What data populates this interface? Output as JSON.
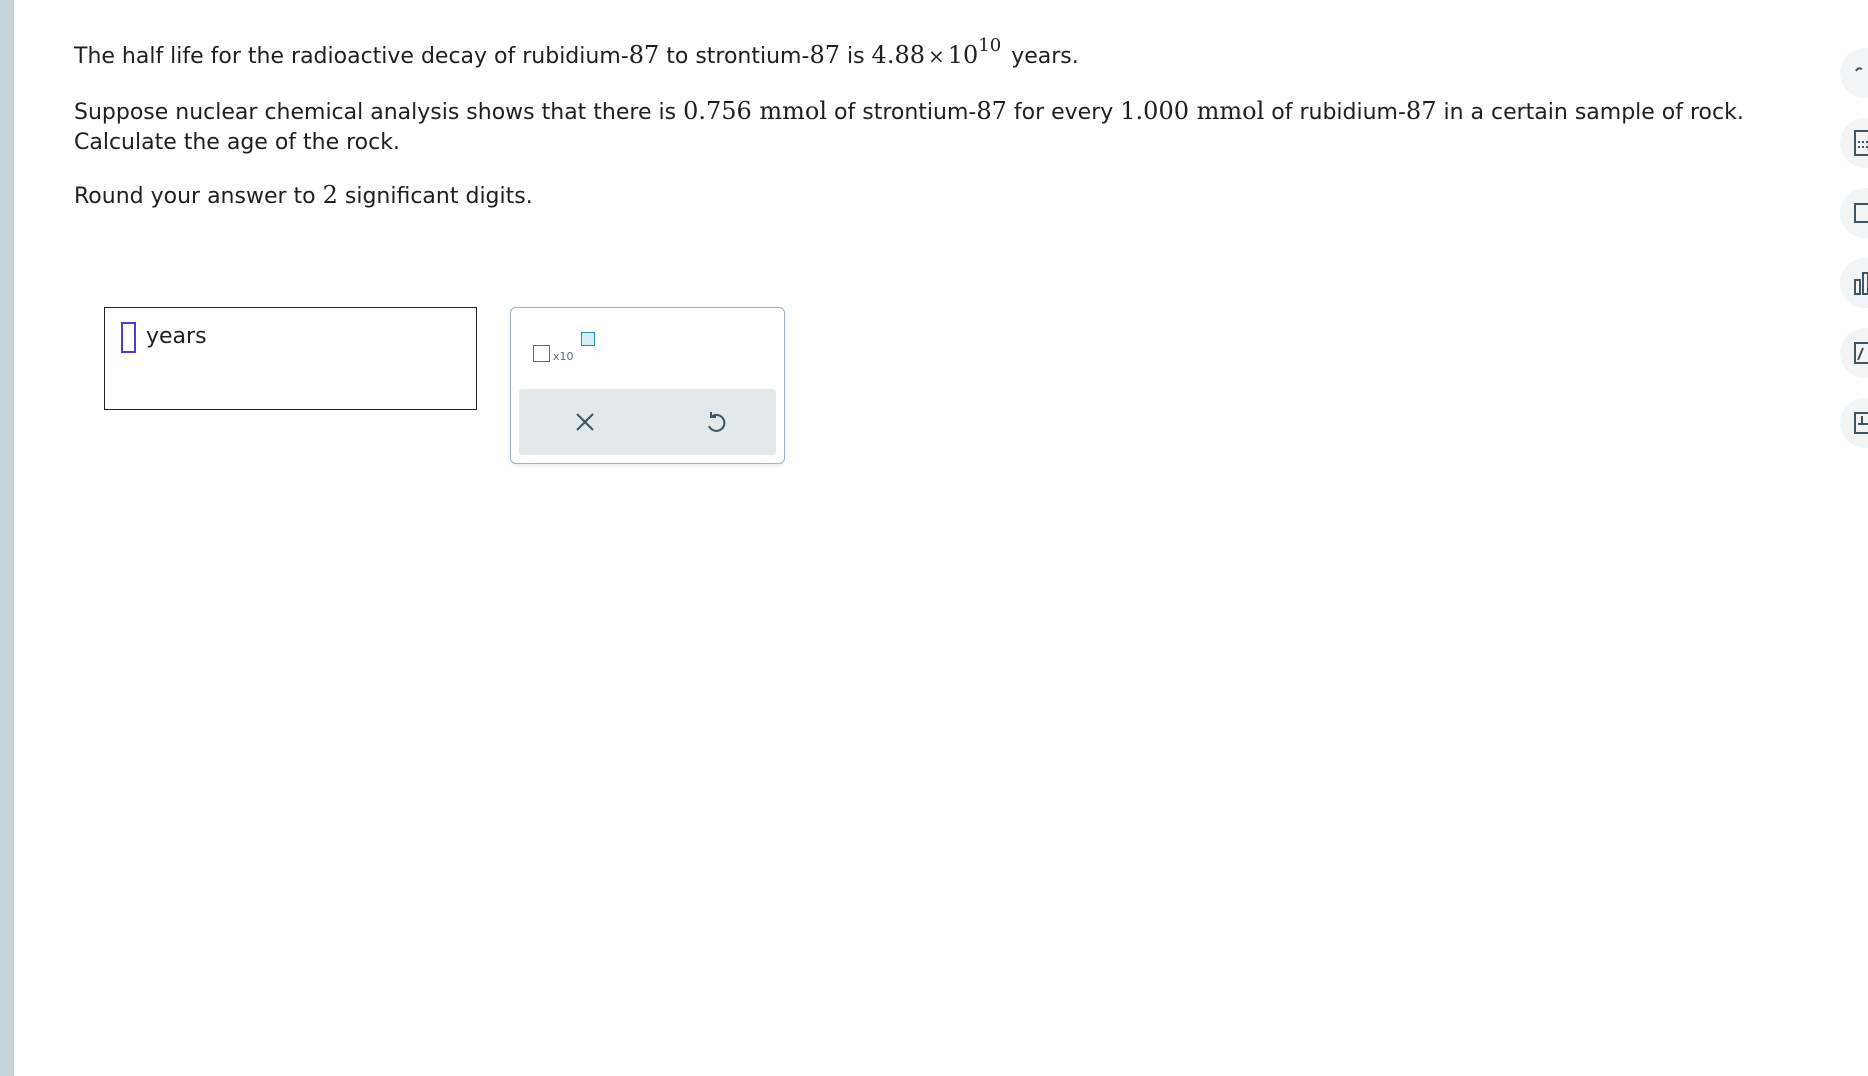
{
  "question": {
    "line1_prefix": "The half life for the radioactive decay of rubidium-",
    "line1_num1": "87",
    "line1_mid": " to strontium-",
    "line1_num2": "87",
    "line1_is": " is ",
    "half_life_mantissa": "4.88",
    "half_life_times": "×",
    "half_life_base": "10",
    "half_life_exponent": "10",
    "line1_suffix": "years.",
    "line2_prefix": "Suppose nuclear chemical analysis shows that there is ",
    "sr_amount": "0.756 mmol",
    "line2_mid1": " of strontium-",
    "line2_num1": "87",
    "line2_mid2": " for every ",
    "rb_amount": "1.000 mmol",
    "line2_mid3": " of rubidium-",
    "line2_num2": "87",
    "line2_suffix": " in a certain sample of rock.",
    "line3": "Calculate the age of the rock.",
    "round_prefix": "Round your answer to ",
    "round_digits": "2",
    "round_suffix": " significant digits."
  },
  "answer": {
    "value": "",
    "unit": "years"
  },
  "tools": {
    "sci_notation_label": "x10"
  },
  "icons": {
    "clear": "close-icon",
    "undo": "undo-icon",
    "accent": "#4a3dd8",
    "exponent_box": "#2c8fb6"
  }
}
